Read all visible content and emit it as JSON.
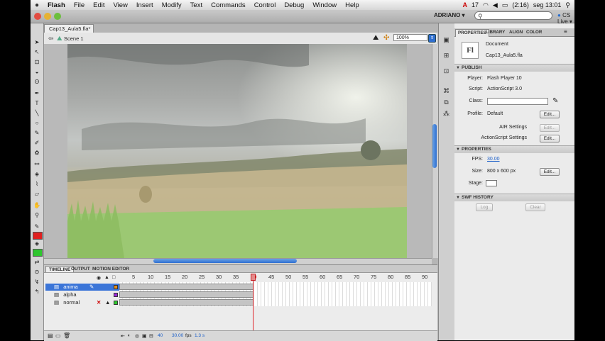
{
  "menubar": {
    "app_name": "Flash",
    "menus": [
      "File",
      "Edit",
      "View",
      "Insert",
      "Modify",
      "Text",
      "Commands",
      "Control",
      "Debug",
      "Window",
      "Help"
    ],
    "status": {
      "adobe_count": "17",
      "battery": "(2:16)",
      "clock": "seg 13:01"
    }
  },
  "appbar": {
    "workspace": "ADRIANO ▾",
    "search_placeholder": "",
    "cs_live": "CS Live"
  },
  "document": {
    "tab_label": "Cap13_Aula5.fla*",
    "scene": "Scene 1",
    "zoom": "100%"
  },
  "timeline": {
    "tabs": [
      "TIMELINE",
      "OUTPUT",
      "MOTION EDITOR"
    ],
    "frame_numbers": [
      "5",
      "10",
      "15",
      "20",
      "25",
      "30",
      "35",
      "40",
      "45",
      "50",
      "55",
      "60",
      "65",
      "70",
      "75",
      "80",
      "85",
      "90"
    ],
    "layers": [
      {
        "name": "anima",
        "selected": true
      },
      {
        "name": "alpha",
        "selected": false
      },
      {
        "name": "normal",
        "selected": false
      }
    ],
    "current_frame": "40",
    "fps": "30.00",
    "fps_unit": "fps",
    "elapsed": "1.3 s"
  },
  "properties": {
    "tabs": [
      "PROPERTIES",
      "LIBRARY",
      "ALIGN",
      "COLOR"
    ],
    "doc_type": "Document",
    "doc_name": "Cap13_Aula5.fla",
    "icon_text": "Fl",
    "publish": {
      "header": "PUBLISH",
      "player_label": "Player:",
      "player": "Flash Player 10",
      "script_label": "Script:",
      "script": "ActionScript 3.0",
      "class_label": "Class:",
      "profile_label": "Profile:",
      "profile": "Default",
      "edit": "Edit...",
      "air_label": "AIR Settings",
      "as_label": "ActionScript Settings"
    },
    "props": {
      "header": "PROPERTIES",
      "fps_label": "FPS:",
      "fps": "30.00",
      "size_label": "Size:",
      "size": "800 x 600 px",
      "stage_label": "Stage:",
      "edit": "Edit..."
    },
    "swf": {
      "header": "SWF HISTORY",
      "log": "Log",
      "clear": "Clear"
    }
  },
  "colors": {
    "accent": "#3b75d8",
    "playhead": "#e0282d",
    "fps_link": "#1b5fc9"
  }
}
